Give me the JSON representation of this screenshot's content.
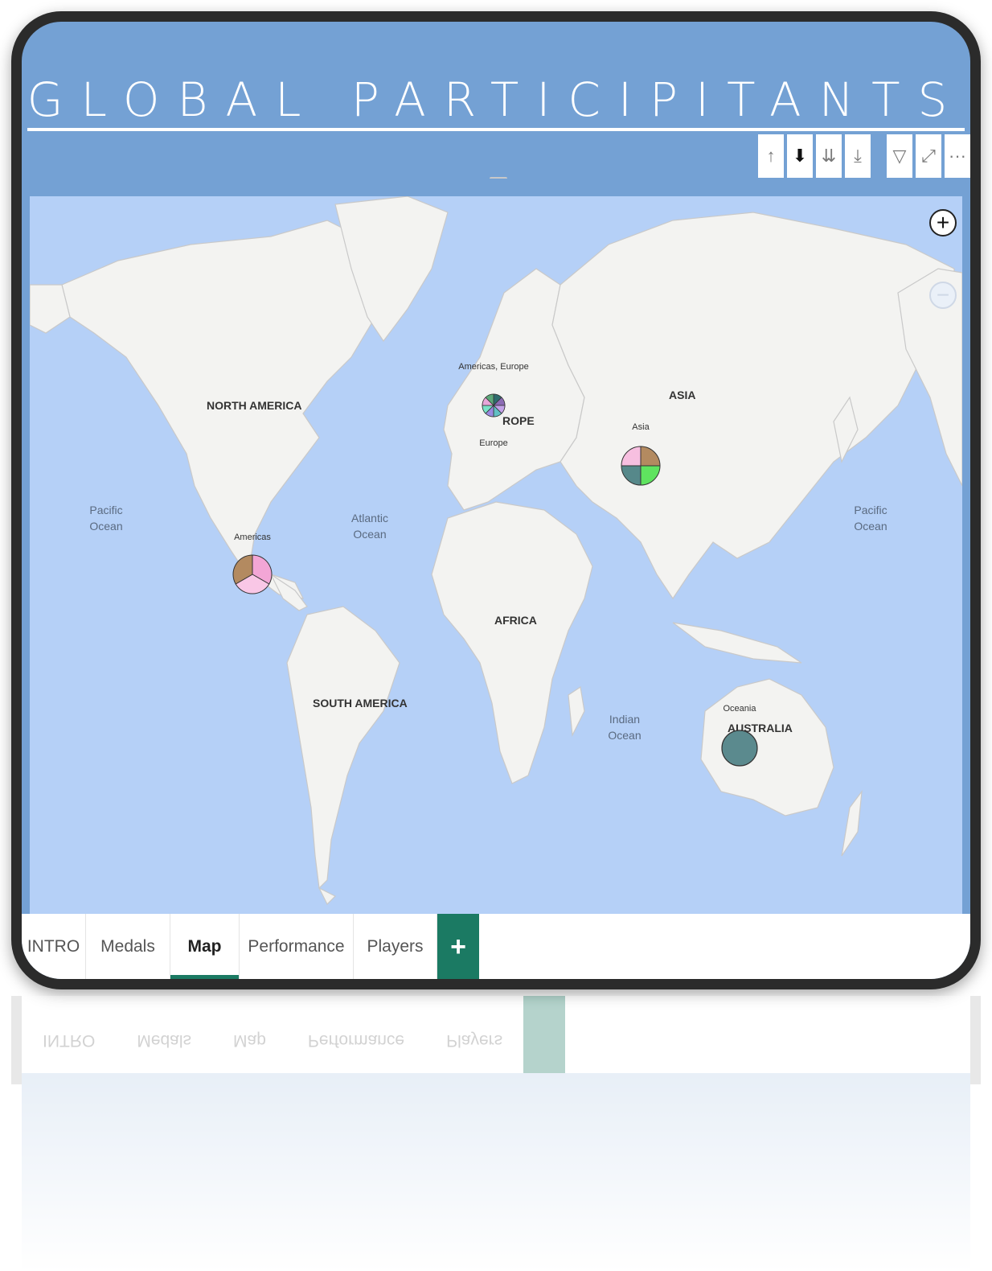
{
  "header": {
    "title": "GLOBAL PARTICIPITANTS"
  },
  "toolbar": {
    "buttons": [
      {
        "name": "drill-up-icon",
        "glyph": "↑"
      },
      {
        "name": "drill-down-icon",
        "glyph": "⬇"
      },
      {
        "name": "next-level-icon",
        "glyph": "⇊"
      },
      {
        "name": "expand-hierarchy-icon",
        "glyph": "⤓"
      },
      {
        "name": "filter-icon",
        "glyph": "▽"
      },
      {
        "name": "focus-mode-icon",
        "glyph": "⤢"
      },
      {
        "name": "more-options-icon",
        "glyph": "···"
      }
    ]
  },
  "map": {
    "zoom_in": "+",
    "zoom_out": "−",
    "labels": {
      "north_america": "NORTH AMERICA",
      "south_america": "SOUTH AMERICA",
      "europe": "ROPE",
      "asia": "ASIA",
      "africa": "AFRICA",
      "australia": "AUSTRALIA",
      "pacific_left_1": "Pacific",
      "pacific_left_2": "Ocean",
      "pacific_right_1": "Pacific",
      "pacific_right_2": "Ocean",
      "atlantic_1": "Atlantic",
      "atlantic_2": "Ocean",
      "indian_1": "Indian",
      "indian_2": "Ocean"
    },
    "pie_labels": {
      "americas": "Americas",
      "americas_europe": "Americas, Europe",
      "europe": "Europe",
      "asia": "Asia",
      "oceania": "Oceania"
    },
    "colors": {
      "ocean": "#b5d0f7",
      "land": "#f3f3f1",
      "border": "#c9c9c9"
    }
  },
  "tabs": [
    {
      "label": "INTRO",
      "active": false
    },
    {
      "label": "Medals",
      "active": false
    },
    {
      "label": "Map",
      "active": true
    },
    {
      "label": "Performance",
      "active": false
    },
    {
      "label": "Players",
      "active": false
    }
  ],
  "tab_add": "+",
  "accent": "#1b7a63"
}
